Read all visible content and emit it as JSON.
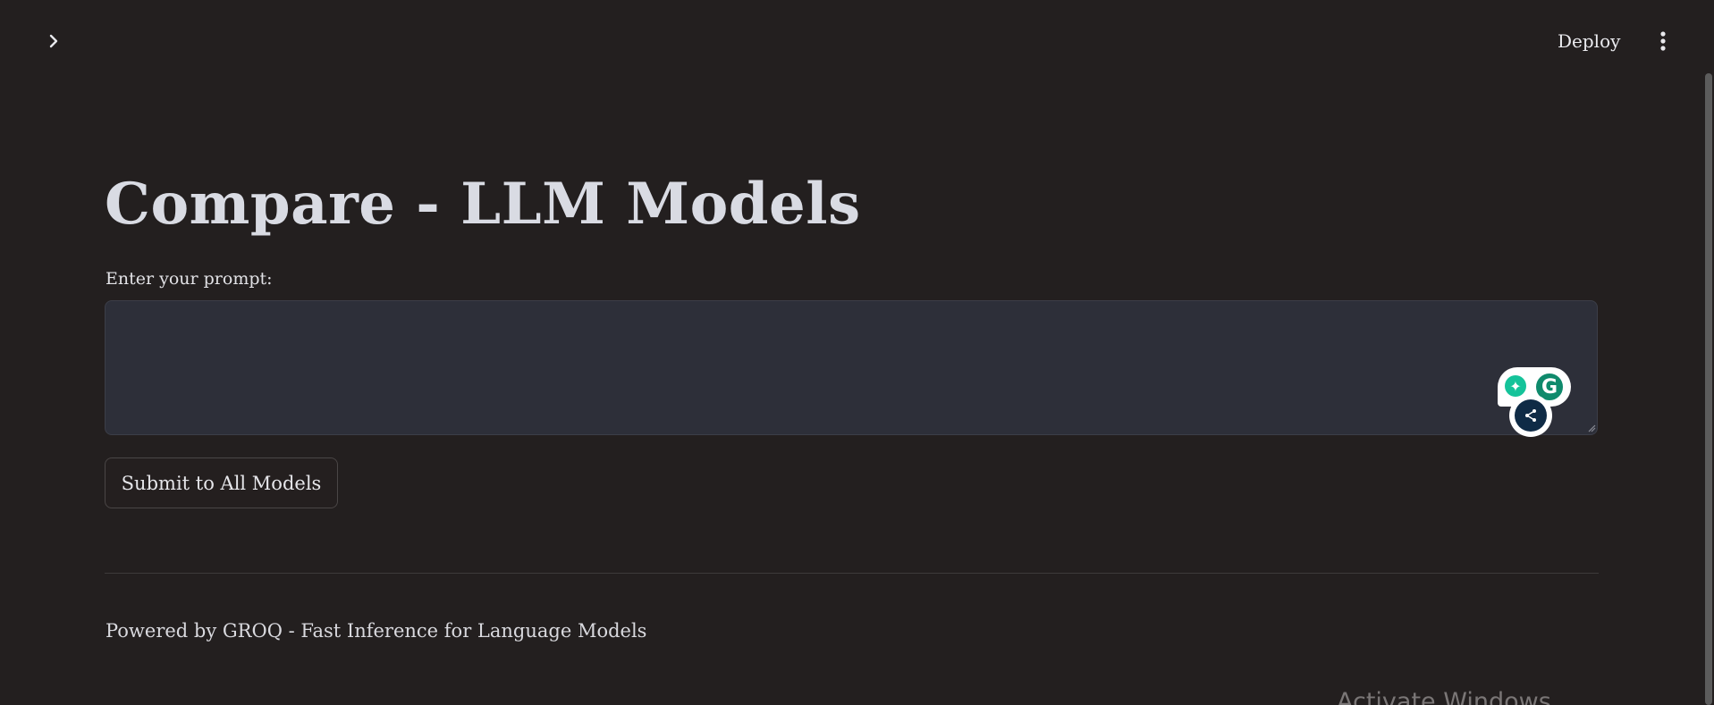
{
  "header": {
    "expand_icon": "chevron-right-icon",
    "deploy_label": "Deploy",
    "menu_icon": "more-vertical-icon"
  },
  "main": {
    "title": "Compare - LLM Models",
    "prompt_label": "Enter your prompt:",
    "prompt_value": "",
    "submit_label": "Submit to All Models",
    "footer": "Powered by GROQ - Fast Inference for Language Models"
  },
  "extensions": {
    "grammarly_letter": "G",
    "ai_spark": "✦",
    "icons": [
      "grammarly-ai-icon",
      "grammarly-icon",
      "deepl-icon"
    ]
  },
  "system": {
    "watermark": "Activate Windows"
  },
  "colors": {
    "background": "#231f1f",
    "input_background": "#2d2f39",
    "title": "#d9dbe3",
    "grammarly_green": "#15c39a",
    "deepl_navy": "#0f2b46"
  }
}
